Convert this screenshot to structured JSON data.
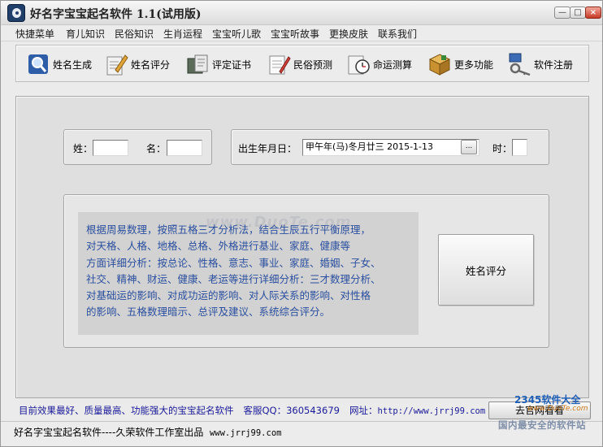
{
  "window": {
    "title": "好名字宝宝起名软件  1.1(试用版)",
    "controls": {
      "minimize": "—",
      "maximize": "□",
      "close": "×"
    }
  },
  "menu": {
    "items": [
      "快捷菜单",
      "育儿知识",
      "民俗知识",
      "生肖运程",
      "宝宝听儿歌",
      "宝宝听故事",
      "更换皮肤",
      "联系我们"
    ]
  },
  "toolbar": {
    "items": [
      {
        "label": "姓名生成",
        "icon": "magnifier-icon"
      },
      {
        "label": "姓名评分",
        "icon": "pen-document-icon"
      },
      {
        "label": "评定证书",
        "icon": "certificate-icon"
      },
      {
        "label": "民俗预测",
        "icon": "notepad-pencil-icon"
      },
      {
        "label": "命运测算",
        "icon": "clock-icon"
      },
      {
        "label": "更多功能",
        "icon": "box-icon"
      },
      {
        "label": "软件注册",
        "icon": "keys-icon"
      }
    ]
  },
  "form": {
    "surname_label": "姓：",
    "surname_value": "",
    "name_label": "名：",
    "name_value": "",
    "birth_label": "出生年月日：",
    "birth_value": "甲午年(马)冬月廿三 2015-1-13",
    "date_button": "...",
    "hour_label": "时：",
    "hour_value": ""
  },
  "description": {
    "text": "根据周易数理，按照五格三才分析法，结合生辰五行平衡原理，\n对天格、人格、地格、总格、外格进行基业、家庭、健康等\n方面详细分析：按总论、性格、意志、事业、家庭、婚姻、子女、\n社交、精神、财运、健康、老运等进行详细分析：三才数理分析、\n对基础运的影响、对成功运的影响、对人际关系的影响、对性格\n的影响、五格数理暗示、总评及建议、系统综合评分。"
  },
  "score_button": {
    "label": "姓名评分"
  },
  "footer": {
    "slogan": "目前效果最好、质量最高、功能强大的宝宝起名软件",
    "qq": "客服QQ：360543679",
    "site_label": "网址：",
    "site_url": "http://www.jrrj99.com",
    "visit_button": "去官网看看"
  },
  "statusbar": {
    "text": "好名字宝宝起名软件----久荣软件工作室出品",
    "url": "www.jrrj99.com"
  },
  "watermarks": {
    "center": "www.DuoTe.com",
    "corner_top": "2345软件大全",
    "corner_mid": "www.DuoTe.com",
    "corner_bottom": "国内最安全的软件站"
  },
  "colors": {
    "description_text": "#2a4f9f",
    "footer_text": "#1a1a9a",
    "panel_bg": "#dfdfdf",
    "window_bg": "#ebebeb"
  }
}
